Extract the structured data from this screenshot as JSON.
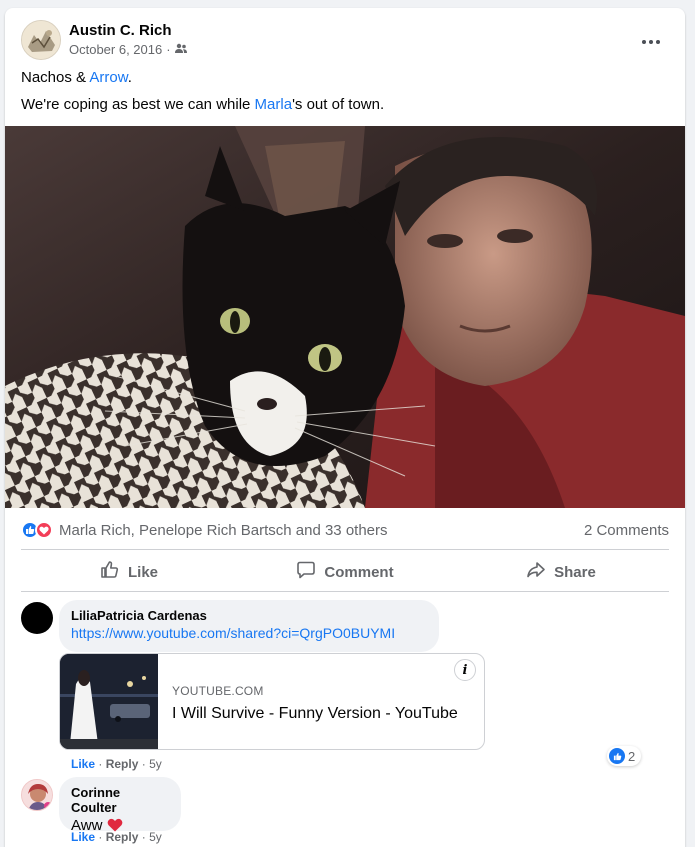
{
  "post": {
    "author": "Austin C. Rich",
    "date": "October 6, 2016",
    "separator": "·",
    "line1_pre": "Nachos & ",
    "line1_link": "Arrow",
    "line1_post": ".",
    "line2_pre": "We're coping as best we can while ",
    "line2_link": "Marla",
    "line2_post": "'s out of town."
  },
  "reactions": {
    "names": "Marla Rich, Penelope Rich Bartsch and 33 others",
    "comments": "2 Comments"
  },
  "actions": {
    "like": "Like",
    "comment": "Comment",
    "share": "Share"
  },
  "comments": [
    {
      "name": "LiliaPatricia Cardenas",
      "text": "https://www.youtube.com/shared?ci=QrgPO0BUYMI",
      "preview_domain": "YOUTUBE.COM",
      "preview_title": "I Will Survive - Funny Version - YouTube",
      "like": "Like",
      "reply": "Reply",
      "age": "5y",
      "like_count": "2"
    },
    {
      "name": "Corinne Coulter",
      "text": "Aww",
      "like": "Like",
      "reply": "Reply",
      "age": "5y"
    }
  ],
  "colors": {
    "link": "#1877f2",
    "like_blue": "#1877f2",
    "love_red": "#f33e58",
    "muted": "#65676b"
  },
  "icons": [
    "more-options-icon",
    "friends-audience-icon",
    "like-reaction-icon",
    "love-reaction-icon",
    "thumbs-up-icon",
    "comment-icon",
    "share-icon",
    "info-icon",
    "heart-icon"
  ]
}
